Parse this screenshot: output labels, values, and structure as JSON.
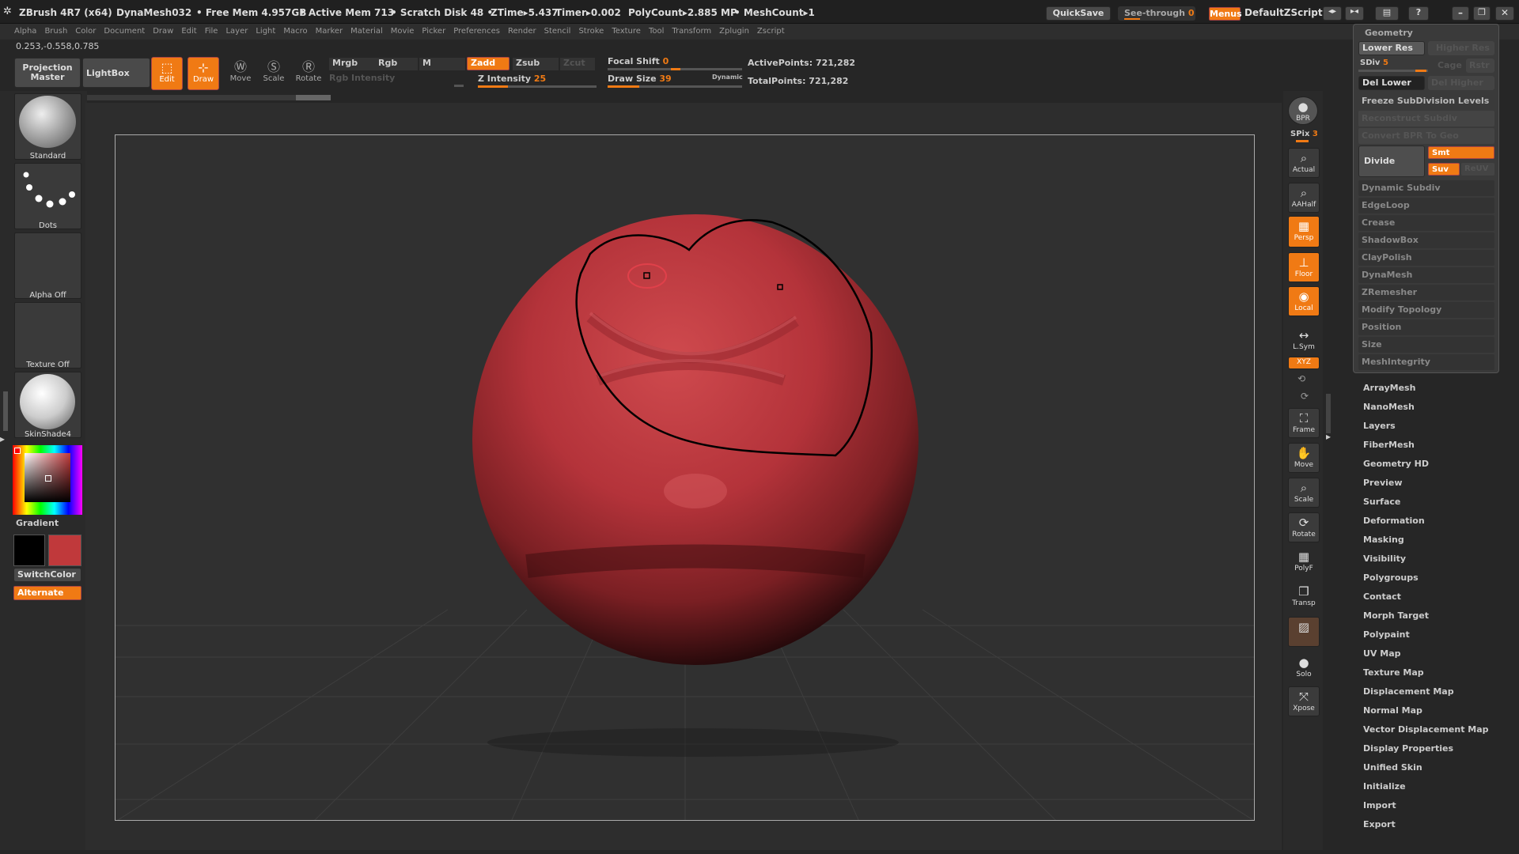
{
  "title": {
    "app": "ZBrush 4R7 (x64)",
    "doc": "DynaMesh032",
    "free_mem": "Free Mem 4.957GB",
    "active_mem": "Active Mem 713",
    "scratch": "Scratch Disk 48",
    "ztime": "ZTime▸5.437",
    "timer": "Timer▸0.002",
    "polycount": "PolyCount▸2.885 MP",
    "meshcount": "MeshCount▸1",
    "quicksave": "QuickSave",
    "seethrough": "See-through",
    "seethrough_val": "0",
    "menus": "Menus",
    "script": "DefaultZScript"
  },
  "menu": [
    "Alpha",
    "Brush",
    "Color",
    "Document",
    "Draw",
    "Edit",
    "File",
    "Layer",
    "Light",
    "Macro",
    "Marker",
    "Material",
    "Movie",
    "Picker",
    "Preferences",
    "Render",
    "Stencil",
    "Stroke",
    "Texture",
    "Tool",
    "Transform",
    "Zplugin",
    "Zscript"
  ],
  "coords": "0.253,-0.558,0.785",
  "toolbar": {
    "projection_master": "Projection Master",
    "lightbox": "LightBox",
    "edit": "Edit",
    "draw": "Draw",
    "move": "Move",
    "scale": "Scale",
    "rotate": "Rotate",
    "mrgb": "Mrgb",
    "rgb": "Rgb",
    "m": "M",
    "zadd": "Zadd",
    "zsub": "Zsub",
    "zcut": "Zcut",
    "rgb_intensity": "Rgb Intensity",
    "z_intensity_label": "Z Intensity",
    "z_intensity_val": "25",
    "z_intensity_level": 0.25,
    "focal_shift_label": "Focal Shift",
    "focal_shift_val": "0",
    "draw_size_label": "Draw Size",
    "draw_size_val": "39",
    "dynamic": "Dynamic",
    "active_points": "ActivePoints: 721,282",
    "total_points": "TotalPoints: 721,282"
  },
  "left": {
    "brush": "Standard",
    "stroke": "Dots",
    "alpha": "Alpha Off",
    "texture": "Texture Off",
    "material": "SkinShade4",
    "gradient": "Gradient",
    "switchcolor": "SwitchColor",
    "alternate": "Alternate",
    "main_color": "#c0393b",
    "secondary_color": "#000000"
  },
  "right": {
    "bpr": "BPR",
    "spix_label": "SPix",
    "spix_val": "3",
    "actual": "Actual",
    "aahalf": "AAHalf",
    "persp": "Persp",
    "floor": "Floor",
    "local": "Local",
    "lsym": "L.Sym",
    "xyz": "XYZ",
    "frame": "Frame",
    "move": "Move",
    "scale": "Scale",
    "rotate": "Rotate",
    "polyf": "PolyF",
    "transp": "Transp",
    "solo": "Solo",
    "xpose": "Xpose"
  },
  "geometry": {
    "title": "Geometry",
    "lower_res": "Lower Res",
    "higher_res": "Higher Res",
    "sdiv_label": "SDiv",
    "sdiv_val": "5",
    "cage": "Cage",
    "rstr": "Rstr",
    "del_lower": "Del Lower",
    "del_higher": "Del Higher",
    "freeze": "Freeze SubDivision Levels",
    "reconstruct": "Reconstruct Subdiv",
    "convert_bpr": "Convert BPR To Geo",
    "divide": "Divide",
    "smt": "Smt",
    "suv": "Suv",
    "reuv": "ReUV",
    "items": [
      "Dynamic Subdiv",
      "EdgeLoop",
      "Crease",
      "ShadowBox",
      "ClayPolish",
      "DynaMesh",
      "ZRemesher",
      "Modify Topology",
      "Position",
      "Size",
      "MeshIntegrity"
    ]
  },
  "tool_subpalettes": [
    "ArrayMesh",
    "NanoMesh",
    "Layers",
    "FiberMesh",
    "Geometry HD",
    "Preview",
    "Surface",
    "Deformation",
    "Masking",
    "Visibility",
    "Polygroups",
    "Contact",
    "Morph Target",
    "Polypaint",
    "UV Map",
    "Texture Map",
    "Displacement Map",
    "Normal Map",
    "Vector Displacement Map",
    "Display Properties",
    "Unified Skin",
    "Initialize",
    "Import",
    "Export"
  ]
}
